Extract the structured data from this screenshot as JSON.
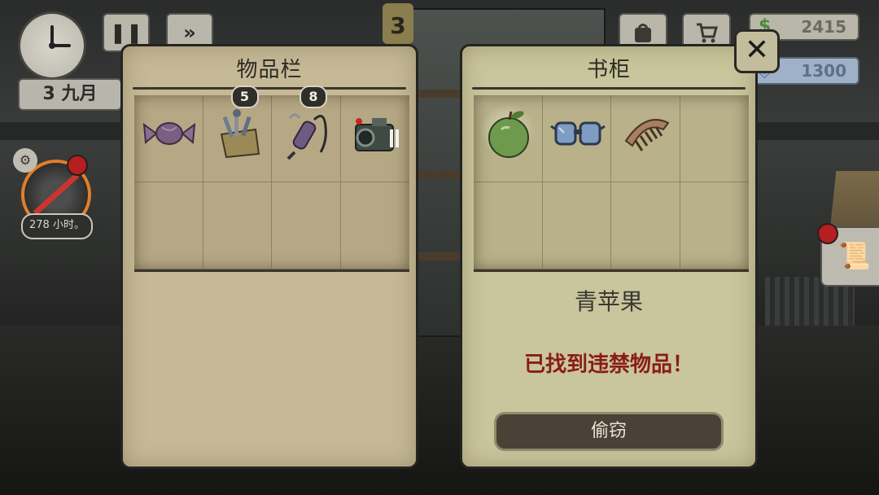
{
  "hud": {
    "date_day": "3",
    "date_month": "九月",
    "pause_label": "❚❚",
    "fast_forward_label": "»",
    "day_number": "3",
    "money": "2415",
    "reputation": "1300",
    "hours_left": "278 小时。"
  },
  "inventory": {
    "title": "物品栏",
    "items": [
      {
        "name": "candy",
        "count": null
      },
      {
        "name": "toolbox",
        "count": "5"
      },
      {
        "name": "soldering-iron",
        "count": "8"
      },
      {
        "name": "camera",
        "count": null
      }
    ]
  },
  "container": {
    "title": "书柜",
    "items": [
      {
        "name": "green-apple"
      },
      {
        "name": "goggles"
      },
      {
        "name": "comb"
      }
    ],
    "selected_item_name": "青苹果",
    "warning": "已找到违禁物品！",
    "steal_label": "偷窃"
  },
  "colors": {
    "left_panel": "#c6b996",
    "right_panel": "#c9c59c",
    "warning": "#8a1c17",
    "alert_dot": "#b51f1f"
  }
}
